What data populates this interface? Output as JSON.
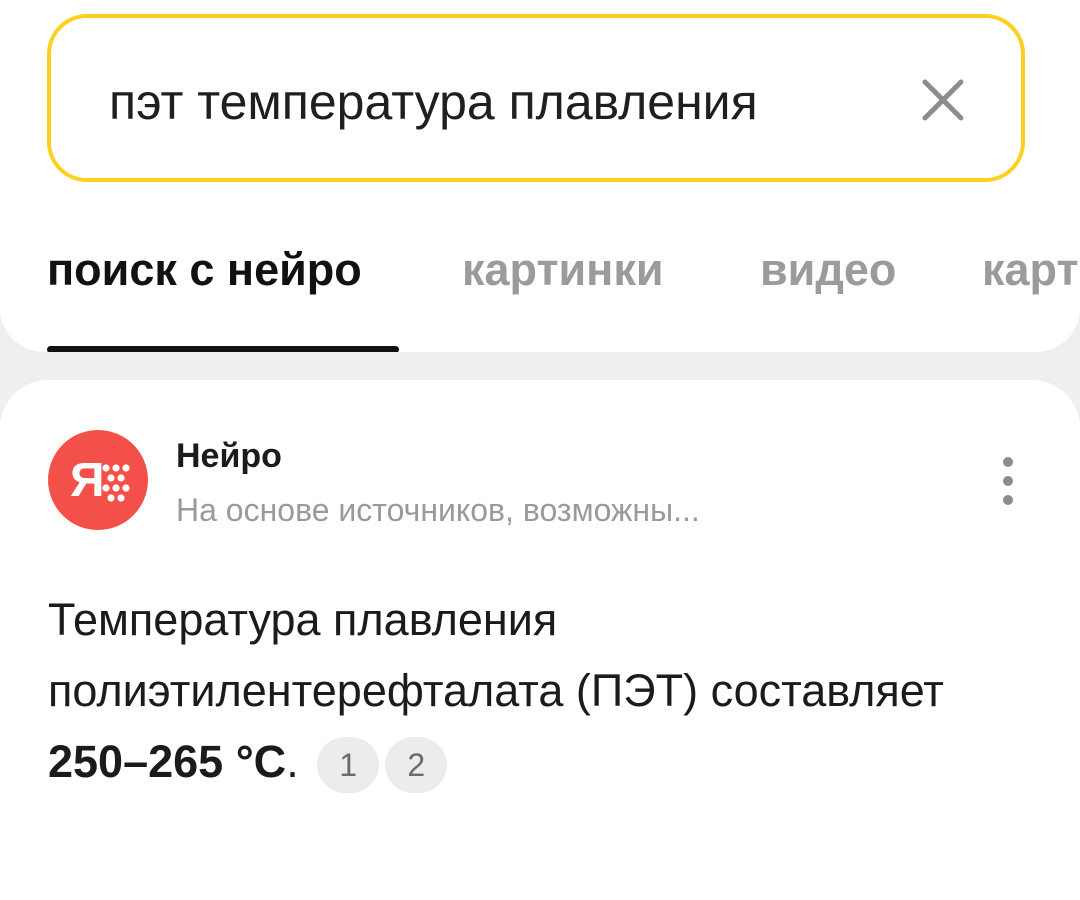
{
  "search": {
    "query": "пэт температура плавления",
    "clear_icon": "close-icon"
  },
  "tabs": [
    {
      "label": "поиск с нейро",
      "active": true
    },
    {
      "label": "картинки",
      "active": false
    },
    {
      "label": "видео",
      "active": false
    },
    {
      "label": "карт",
      "active": false
    }
  ],
  "card": {
    "avatar_icon": "yandex-neiro-logo",
    "title": "Нейро",
    "subtitle": "На основе источников, возможны...",
    "more_icon": "more-vertical-icon",
    "answer_prefix": "Температура плавления полиэтилентерефталата (ПЭТ) составляет ",
    "answer_bold": "250–265 °C",
    "answer_suffix": ".",
    "citations": [
      "1",
      "2"
    ]
  },
  "colors": {
    "search_border": "#fdd020",
    "avatar_bg": "#f3504a",
    "background": "#efefef"
  }
}
